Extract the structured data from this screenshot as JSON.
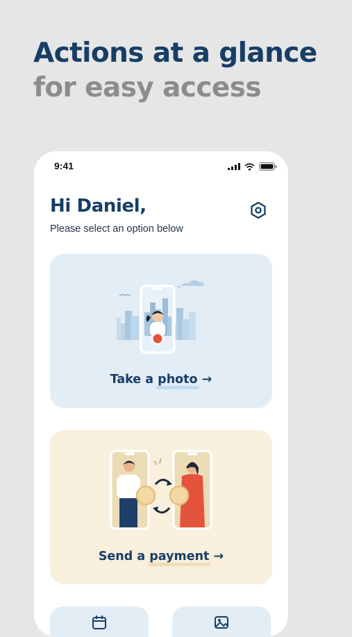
{
  "headline": {
    "line1": "Actions at a glance",
    "line2": "for easy access"
  },
  "status_bar": {
    "time": "9:41",
    "icons": [
      "cellular-signal-icon",
      "wifi-icon",
      "battery-icon"
    ]
  },
  "home": {
    "greeting": "Hi Daniel,",
    "subtitle": "Please select an option below",
    "settings_icon": "settings-hexagon-icon"
  },
  "cards": [
    {
      "label_prefix": "Take a ",
      "label_highlight": "photo",
      "arrow": "→",
      "illustration": "phone-camera-city-illustration",
      "background": "#e3edf6"
    },
    {
      "label_prefix": "Send a ",
      "label_highlight": "payment",
      "arrow": "→",
      "illustration": "phones-exchanging-coins-illustration",
      "background": "#f8efdd"
    }
  ],
  "mini_cards": [
    {
      "icon": "calendar-icon"
    },
    {
      "icon": "gallery-icon"
    }
  ],
  "colors": {
    "background": "#e6e6e7",
    "navy": "#173e66",
    "gray_heading": "#8c8c8e",
    "photo_card": "#e3edf6",
    "payment_card": "#f8efdd",
    "record_red": "#e4533e"
  }
}
